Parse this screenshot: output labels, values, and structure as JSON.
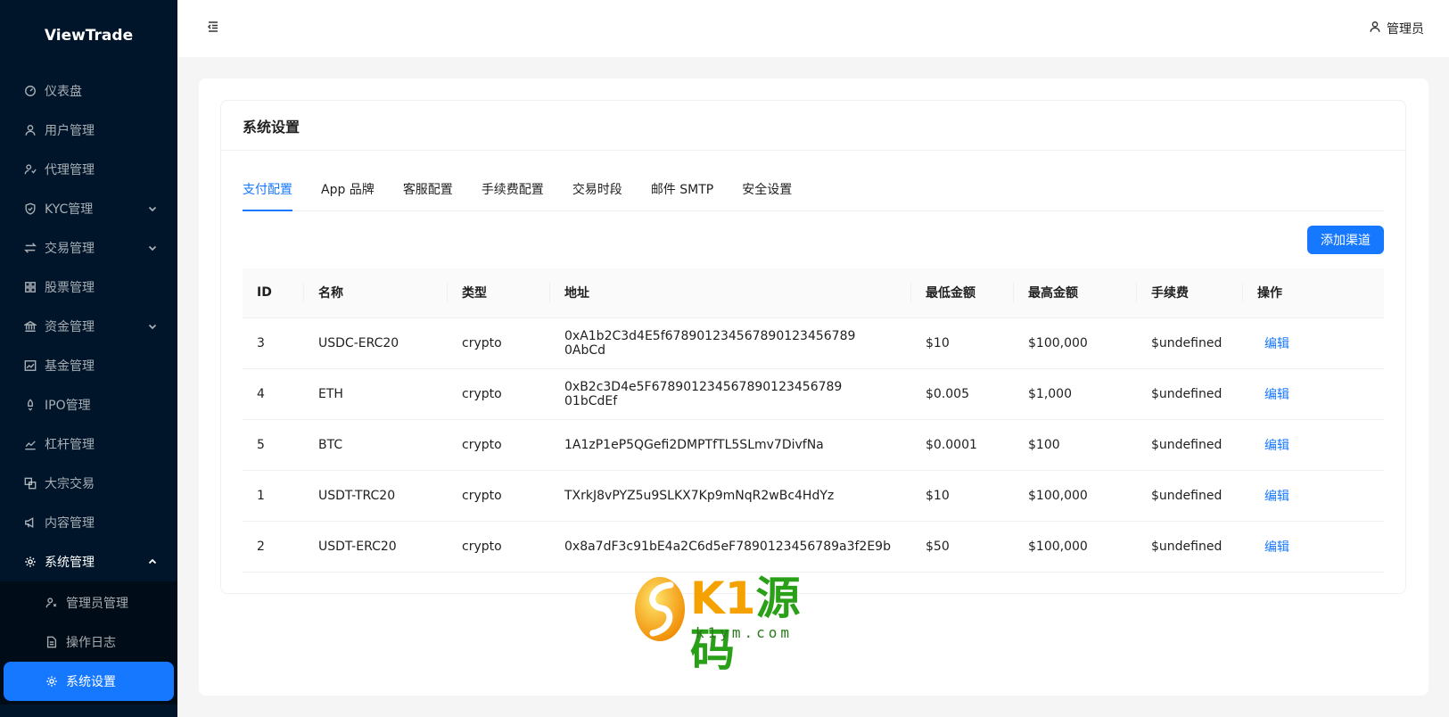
{
  "app": {
    "logo": "ViewTrade"
  },
  "header": {
    "user_name": "管理员"
  },
  "sidebar": {
    "items": [
      {
        "label": "仪表盘",
        "icon": "dashboard-icon"
      },
      {
        "label": "用户管理",
        "icon": "user-icon"
      },
      {
        "label": "代理管理",
        "icon": "agent-icon"
      },
      {
        "label": "KYC管理",
        "icon": "shield-icon",
        "expandable": true
      },
      {
        "label": "交易管理",
        "icon": "swap-icon",
        "expandable": true
      },
      {
        "label": "股票管理",
        "icon": "grid-icon"
      },
      {
        "label": "资金管理",
        "icon": "bank-icon",
        "expandable": true
      },
      {
        "label": "基金管理",
        "icon": "fund-chart-icon"
      },
      {
        "label": "IPO管理",
        "icon": "rocket-icon"
      },
      {
        "label": "杠杆管理",
        "icon": "line-chart-icon"
      },
      {
        "label": "大宗交易",
        "icon": "block-icon"
      },
      {
        "label": "内容管理",
        "icon": "megaphone-icon"
      },
      {
        "label": "系统管理",
        "icon": "gear-icon",
        "expanded": true
      }
    ],
    "submenu": [
      {
        "label": "管理员管理",
        "icon": "admin-icon"
      },
      {
        "label": "操作日志",
        "icon": "file-icon"
      },
      {
        "label": "系统设置",
        "icon": "gear-icon",
        "active": true
      }
    ]
  },
  "card": {
    "title": "系统设置"
  },
  "tabs": [
    "支付配置",
    "App 品牌",
    "客服配置",
    "手续费配置",
    "交易时段",
    "邮件 SMTP",
    "安全设置"
  ],
  "toolbar": {
    "add_label": "添加渠道"
  },
  "table": {
    "columns": [
      "ID",
      "名称",
      "类型",
      "地址",
      "最低金额",
      "最高金额",
      "手续费",
      "操作"
    ],
    "rows": [
      [
        "3",
        "USDC-ERC20",
        "crypto",
        "0xA1b2C3d4E5f678901234567890123456789 0AbCd",
        "$10",
        "$100,000",
        "$undefined",
        "编辑"
      ],
      [
        "4",
        "ETH",
        "crypto",
        "0xB2c3D4e5F678901234567890123456789 01bCdEf",
        "$0.005",
        "$1,000",
        "$undefined",
        "编辑"
      ],
      [
        "5",
        "BTC",
        "crypto",
        "1A1zP1eP5QGefi2DMPTfTL5SLmv7DivfNa",
        "$0.0001",
        "$100",
        "$undefined",
        "编辑"
      ],
      [
        "1",
        "USDT-TRC20",
        "crypto",
        "TXrkJ8vPYZ5u9SLKX7Kp9mNqR2wBc4HdYz",
        "$10",
        "$100,000",
        "$undefined",
        "编辑"
      ],
      [
        "2",
        "USDT-ERC20",
        "crypto",
        "0x8a7dF3c91bE4a2C6d5eF7890123456789a3f2E9b",
        "$50",
        "$100,000",
        "$undefined",
        "编辑"
      ]
    ]
  },
  "watermark": {
    "brand_k": "K1",
    "brand_han": "源码",
    "url": "k1ym.com"
  }
}
